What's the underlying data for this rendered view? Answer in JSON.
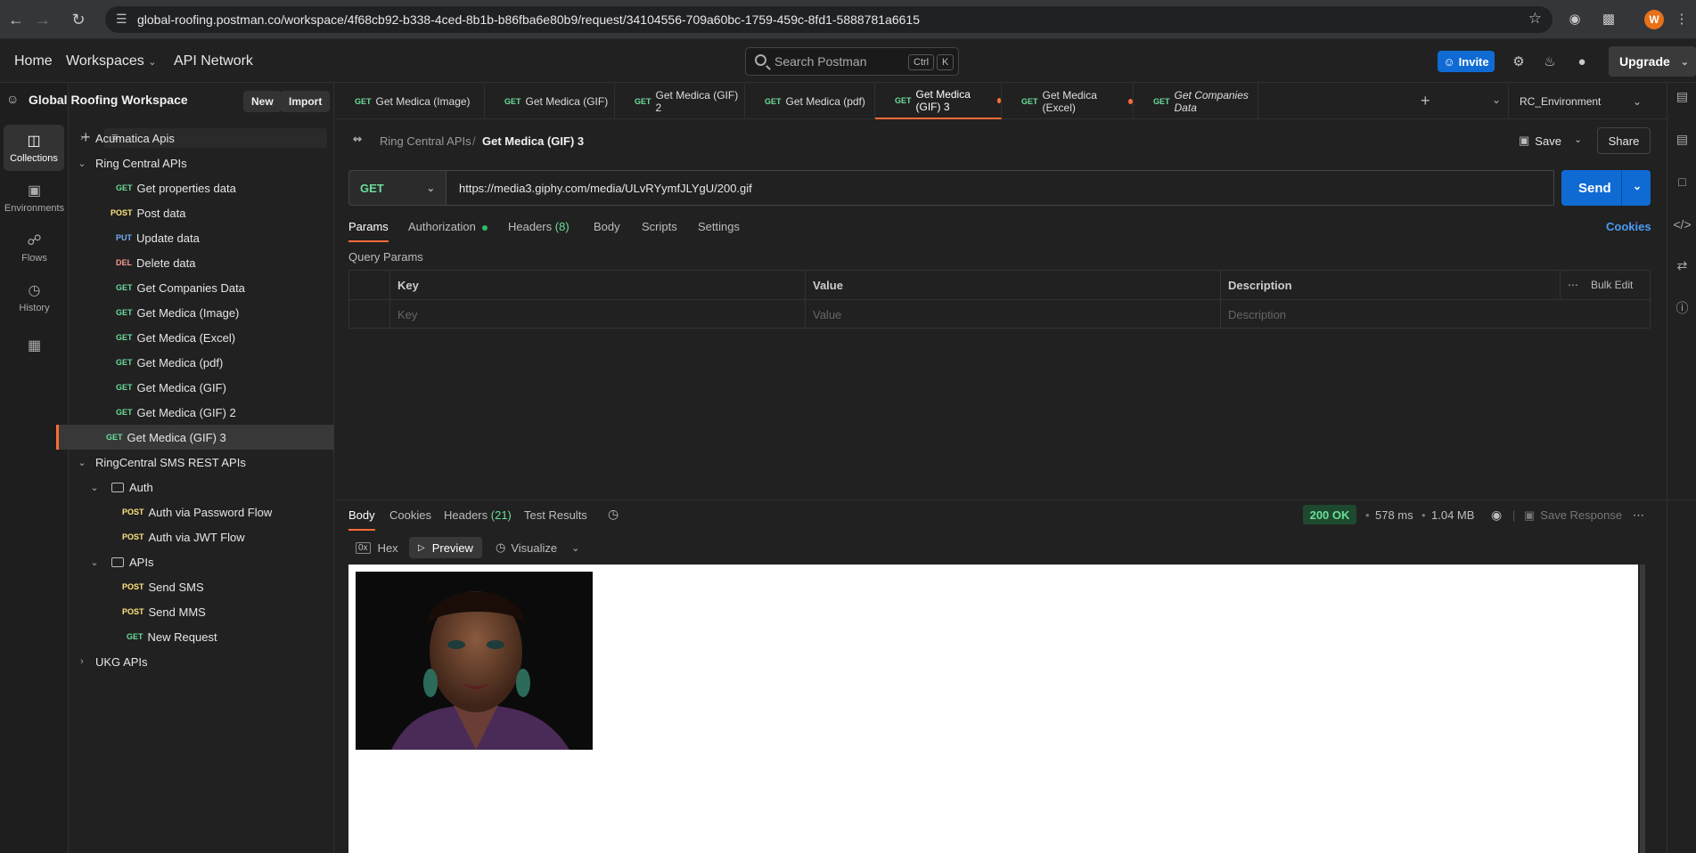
{
  "browser": {
    "url": "global-roofing.postman.co/workspace/4f68cb92-b338-4ced-8b1b-b86fba6e80b9/request/34104556-709a60bc-1759-459c-8fd1-5888781a6615",
    "profile_initial": "W"
  },
  "header": {
    "home": "Home",
    "workspaces": "Workspaces",
    "api_network": "API Network",
    "search_placeholder": "Search Postman",
    "kbd_ctrl": "Ctrl",
    "kbd_k": "K",
    "invite": "Invite",
    "upgrade": "Upgrade"
  },
  "rail": [
    {
      "label": "Collections",
      "icon": "collections-icon"
    },
    {
      "label": "Environments",
      "icon": "environments-icon"
    },
    {
      "label": "Flows",
      "icon": "flows-icon"
    },
    {
      "label": "History",
      "icon": "history-icon"
    }
  ],
  "sidebar": {
    "workspace": "Global Roofing Workspace",
    "new": "New",
    "import": "Import",
    "tree": [
      {
        "type": "collection",
        "label": "Acumatica Apis",
        "open": false
      },
      {
        "type": "collection",
        "label": "Ring Central APIs",
        "open": true
      },
      {
        "type": "request",
        "method": "GET",
        "label": "Get properties data"
      },
      {
        "type": "request",
        "method": "POST",
        "label": "Post data"
      },
      {
        "type": "request",
        "method": "PUT",
        "label": "Update data"
      },
      {
        "type": "request",
        "method": "DEL",
        "label": "Delete data"
      },
      {
        "type": "request",
        "method": "GET",
        "label": "Get Companies Data"
      },
      {
        "type": "request",
        "method": "GET",
        "label": "Get Medica (Image)"
      },
      {
        "type": "request",
        "method": "GET",
        "label": "Get Medica (Excel)"
      },
      {
        "type": "request",
        "method": "GET",
        "label": "Get Medica (pdf)"
      },
      {
        "type": "request",
        "method": "GET",
        "label": "Get Medica (GIF)"
      },
      {
        "type": "request",
        "method": "GET",
        "label": "Get Medica (GIF) 2"
      },
      {
        "type": "request",
        "method": "GET",
        "label": "Get Medica (GIF) 3",
        "selected": true
      },
      {
        "type": "collection",
        "label": "RingCentral SMS REST APIs",
        "open": true
      },
      {
        "type": "folder",
        "label": "Auth"
      },
      {
        "type": "request2",
        "method": "POST",
        "label": "Auth via Password Flow"
      },
      {
        "type": "request2",
        "method": "POST",
        "label": "Auth via JWT Flow"
      },
      {
        "type": "folder",
        "label": "APIs"
      },
      {
        "type": "request2",
        "method": "POST",
        "label": "Send SMS"
      },
      {
        "type": "request2",
        "method": "POST",
        "label": "Send MMS"
      },
      {
        "type": "request3",
        "method": "GET",
        "label": "New Request"
      },
      {
        "type": "collection",
        "label": "UKG APIs",
        "open": false
      }
    ]
  },
  "tabs": [
    {
      "method": "GET",
      "label": "Get Medica (Image)"
    },
    {
      "method": "GET",
      "label": "Get Medica (GIF)"
    },
    {
      "method": "GET",
      "label": "Get Medica (GIF) 2"
    },
    {
      "method": "GET",
      "label": "Get Medica (pdf)"
    },
    {
      "method": "GET",
      "label": "Get Medica (GIF) 3",
      "active": true,
      "unsaved": true
    },
    {
      "method": "GET",
      "label": "Get Medica (Excel)",
      "unsaved": true
    },
    {
      "method": "GET",
      "label": "Get Companies Data",
      "italic": true
    }
  ],
  "environment": "RC_Environment",
  "request": {
    "collection": "Ring Central APIs",
    "separator": "/",
    "name": "Get Medica (GIF) 3",
    "save": "Save",
    "share": "Share",
    "method": "GET",
    "url": "https://media3.giphy.com/media/ULvRYymfJLYgU/200.gif",
    "send": "Send",
    "tabs": {
      "params": "Params",
      "authorization": "Authorization",
      "headers": "Headers",
      "headers_count": "(8)",
      "body": "Body",
      "scripts": "Scripts",
      "settings": "Settings"
    },
    "cookies": "Cookies",
    "query_params_title": "Query Params",
    "table": {
      "col_key": "Key",
      "col_value": "Value",
      "col_description": "Description",
      "bulk_edit": "Bulk Edit",
      "ph_key": "Key",
      "ph_value": "Value",
      "ph_description": "Description"
    }
  },
  "response": {
    "tabs": {
      "body": "Body",
      "cookies": "Cookies",
      "headers": "Headers",
      "headers_count": "(21)",
      "test_results": "Test Results"
    },
    "status": "200 OK",
    "time": "578 ms",
    "size": "1.04 MB",
    "save_response": "Save Response",
    "view": {
      "hex_icon": "0x",
      "hex": "Hex",
      "preview": "Preview",
      "visualize": "Visualize"
    }
  }
}
